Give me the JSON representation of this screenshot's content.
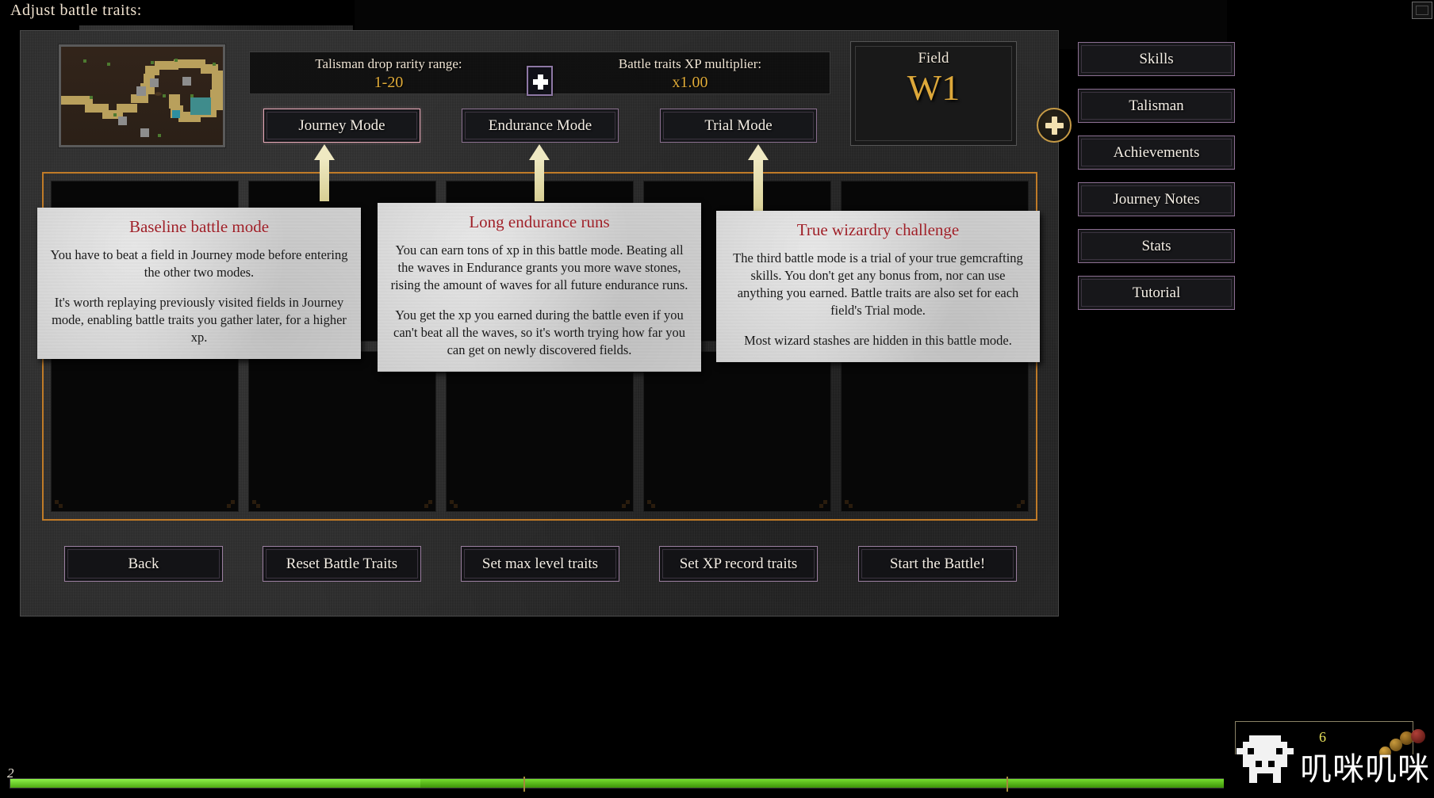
{
  "header": {
    "title": "Adjust battle traits:"
  },
  "info": {
    "rarity_label": "Talisman drop rarity range:",
    "rarity_value": "1-20",
    "xp_label": "Battle traits XP multiplier:",
    "xp_value": "x1.00",
    "plus_icon": "plus-icon"
  },
  "modes": [
    {
      "label": "Journey Mode",
      "selected": true
    },
    {
      "label": "Endurance Mode",
      "selected": false
    },
    {
      "label": "Trial Mode",
      "selected": false
    }
  ],
  "field": {
    "label": "Field",
    "value": "W1",
    "add_icon": "plus-circle-icon"
  },
  "sidebar": {
    "items": [
      {
        "label": "Skills"
      },
      {
        "label": "Talisman"
      },
      {
        "label": "Achievements"
      },
      {
        "label": "Journey Notes"
      },
      {
        "label": "Stats"
      },
      {
        "label": "Tutorial"
      }
    ]
  },
  "bottom_buttons": [
    {
      "label": "Back"
    },
    {
      "label": "Reset Battle Traits"
    },
    {
      "label": "Set max level traits"
    },
    {
      "label": "Set XP record traits"
    },
    {
      "label": "Start the Battle!"
    }
  ],
  "tooltips": [
    {
      "title": "Baseline battle mode",
      "p1": "You have to beat a field in Journey mode before entering the other two modes.",
      "p2": "It's worth replaying previously visited fields in Journey mode, enabling battle traits you gather later, for a higher xp."
    },
    {
      "title": "Long endurance runs",
      "p1": "You can earn tons of xp in this battle mode. Beating all the waves in Endurance grants you more wave stones, rising the amount of waves for all future endurance runs.",
      "p2": "You get the xp you earned during the battle even if you can't beat all the waves, so it's worth trying how far you can get on newly discovered fields."
    },
    {
      "title": "True wizardry challenge",
      "p1": "The third battle mode is a trial of your true gemcrafting skills. You don't get any bonus from, nor can use anything you earned. Battle traits are also set for each field's Trial mode.",
      "p2": "Most wizard stashes are hidden in this battle mode."
    }
  ],
  "hud": {
    "xp_level": "2",
    "logo_count": "6",
    "logo_text": "叽咪叽咪",
    "invader_icon": "space-invader-icon"
  },
  "colors": {
    "accent_gold": "#e0ab38",
    "grid_border": "#c07b28",
    "button_border": "#8a6f8f",
    "selected_border": "#e6a8b6",
    "tooltip_title": "#9e1f27",
    "xp_green": "#8ef24a"
  }
}
